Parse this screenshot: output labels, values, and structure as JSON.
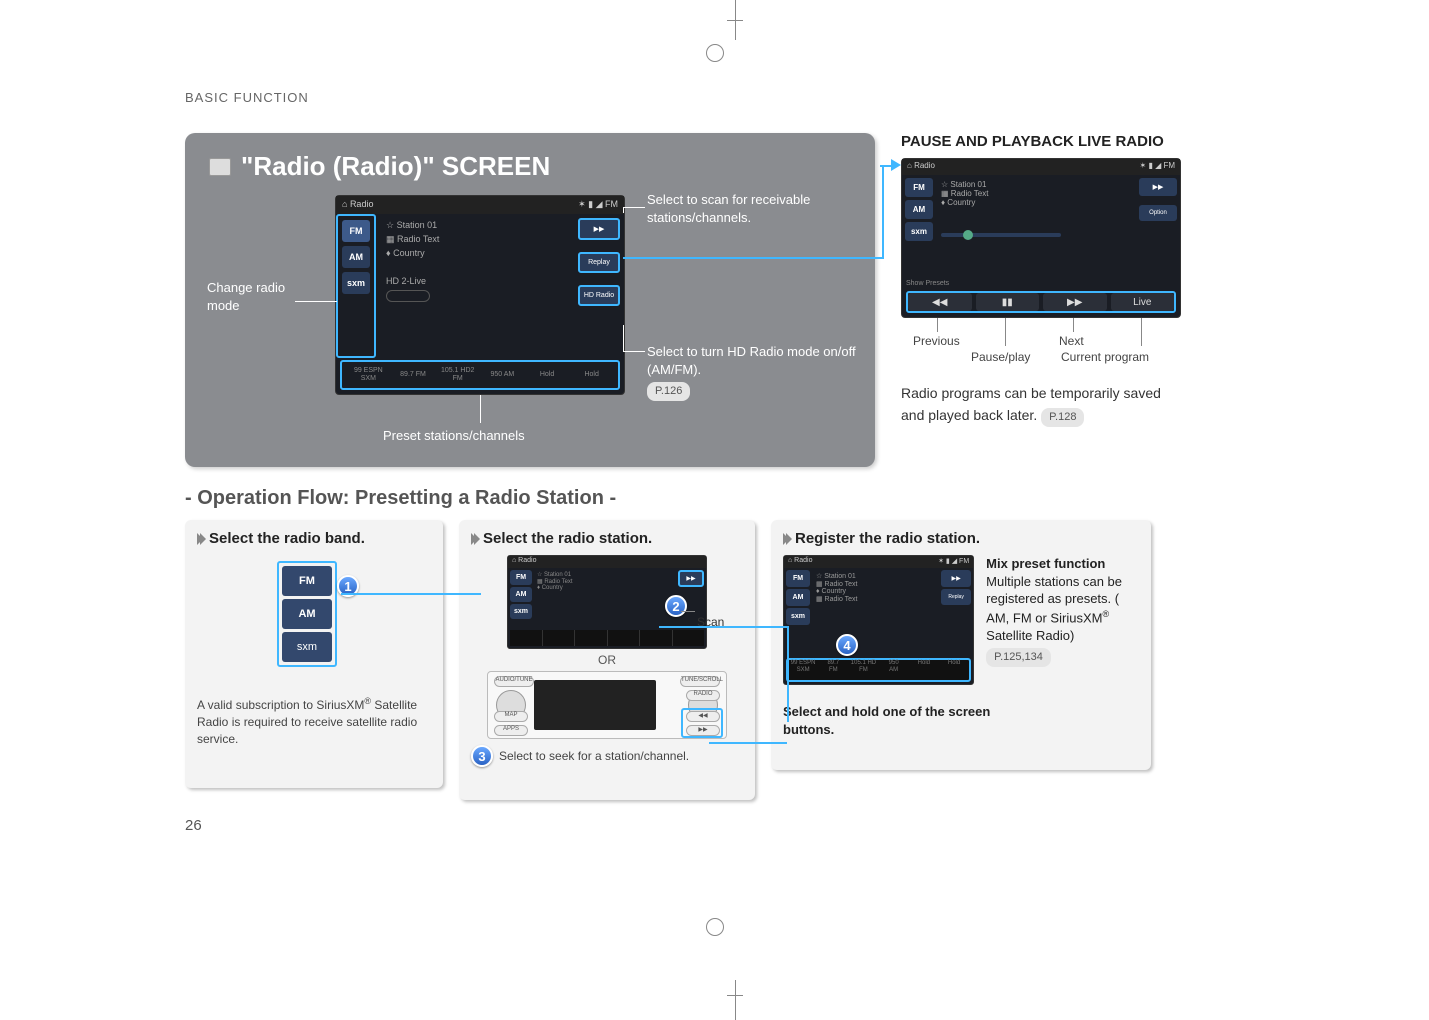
{
  "header": {
    "section": "BASIC FUNCTION"
  },
  "main_panel": {
    "title": "\"Radio (Radio)\" SCREEN",
    "callout_change_mode": "Change radio mode",
    "callout_scan": "Select to scan for receivable stations/channels.",
    "callout_hd": "Select to turn HD Radio mode on/off (AM/FM).",
    "callout_hd_pageref": "P.126",
    "callout_presets": "Preset stations/channels",
    "screen": {
      "status_title": "Radio",
      "modes": [
        "FM",
        "AM",
        "sxm"
      ],
      "info_lines": [
        "☆ Station 01",
        "▦ Radio Text",
        "♦ Country"
      ],
      "hd_label": "HD 2-Live",
      "right_buttons": [
        "▶▶",
        "Replay",
        "HD Radio"
      ],
      "preset_cells": [
        "99 ESPN SXM",
        "89.7 FM",
        "105.1 HD2 FM",
        "950 AM",
        "Hold",
        "Hold"
      ]
    }
  },
  "side": {
    "title": "PAUSE AND PLAYBACK LIVE RADIO",
    "labels": {
      "previous": "Previous",
      "pause_play": "Pause/play",
      "next": "Next",
      "current": "Current program"
    },
    "controls": [
      "◀◀",
      "▮▮",
      "▶▶",
      "Live"
    ],
    "screen": {
      "status_title": "Radio",
      "modes": [
        "FM",
        "AM",
        "sxm"
      ],
      "info_lines": [
        "☆ Station 01",
        "▦ Radio Text",
        "♦ Country"
      ],
      "show_presets": "Show Presets"
    },
    "note_line": "Radio programs can be temporarily saved and played back later.",
    "note_pageref": "P.128"
  },
  "op_flow": {
    "title": "- Operation Flow: Presetting a Radio Station -",
    "card1": {
      "heading": "Select the radio band.",
      "bands": [
        "FM",
        "AM",
        "sxm"
      ],
      "num": "1",
      "note_prefix": "A valid subscription to SiriusXM",
      "note_suffix": " Satellite Radio is required to receive satellite radio service."
    },
    "card2": {
      "heading": "Select the radio station.",
      "num_scan": "2",
      "scan_label": "Scan",
      "or_label": "OR",
      "num_seek": "3",
      "seek_note": "Select to seek for a station/channel.",
      "hw_buttons_left": [
        "AUDIO/TUNE",
        "MAP",
        "APPS"
      ],
      "hw_buttons_right": [
        "TUNE/SCROLL",
        "RADIO",
        "◀◀",
        "▶▶"
      ]
    },
    "card3": {
      "heading": "Register the radio station.",
      "num": "4",
      "mix_title": "Mix preset function",
      "mix_body_prefix": "Multiple stations can be registered as presets. ( AM, FM or SiriusXM",
      "mix_body_suffix": " Satellite Radio)",
      "mix_pageref": "P.125,134",
      "hold_note": "Select and hold one of the screen buttons."
    }
  },
  "page_number": "26"
}
